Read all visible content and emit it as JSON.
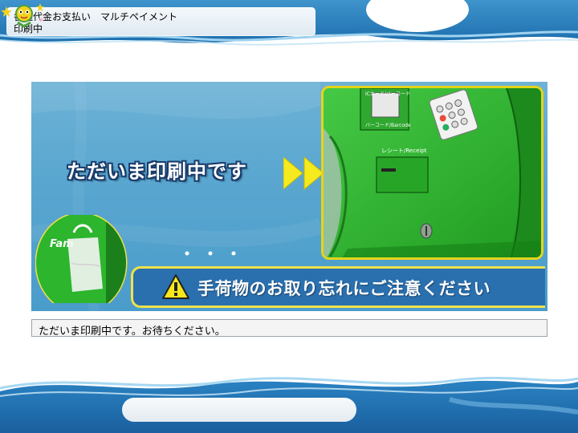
{
  "header": {
    "title_line1": "各種代金お支払い　マルチペイメント",
    "title_line2": "印刷中",
    "mascot_icon": "star-mascot-icon"
  },
  "panel": {
    "message": "ただいま印刷中です",
    "arrow_icon": "double-chevron-right-icon",
    "terminal": {
      "slot_label_top": "ICカード/バーコード",
      "barcode_label": "バーコード/Barcode",
      "receipt_label": "レシート/Receipt"
    },
    "bag_photo_text": "Fam",
    "warning_icon": "warning-triangle-icon",
    "warning_text": "手荷物のお取り忘れにご注意ください"
  },
  "status": {
    "text": "ただいま印刷中です。お待ちください。"
  },
  "colors": {
    "panel_blue": "#5aa7d0",
    "terminal_green": "#2fb62f",
    "accent_yellow": "#f0e24a",
    "warning_bar": "#2a6fae"
  }
}
